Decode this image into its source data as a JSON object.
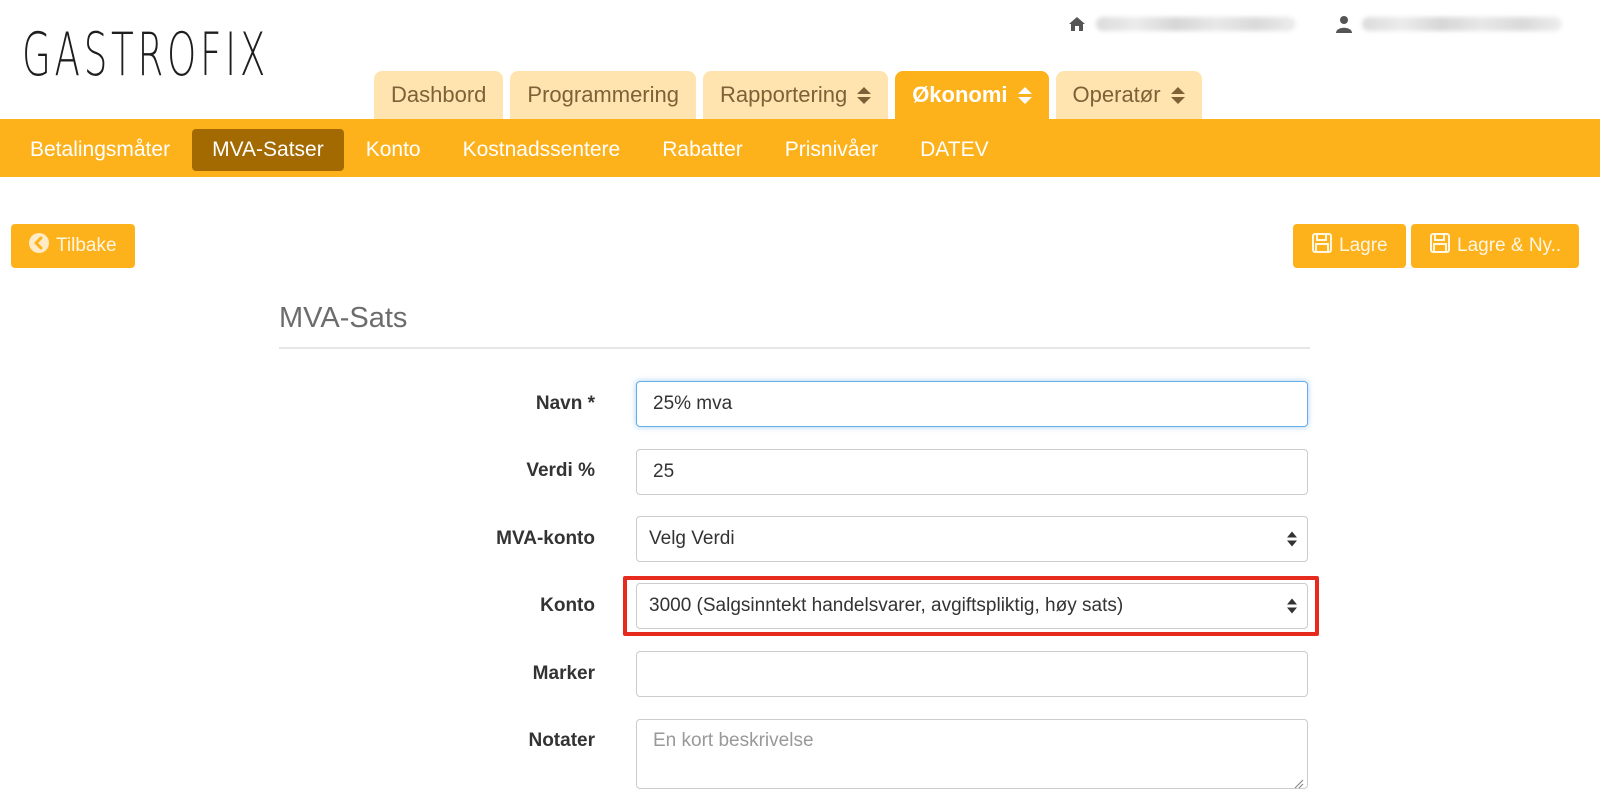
{
  "logo": {
    "text": "GASTROFIX"
  },
  "topbar": {
    "home_icon": "home-icon",
    "user_icon": "user-icon"
  },
  "main_tabs": [
    {
      "label": "Dashbord",
      "has_dropdown": false,
      "active": false
    },
    {
      "label": "Programmering",
      "has_dropdown": false,
      "active": false
    },
    {
      "label": "Rapportering",
      "has_dropdown": true,
      "active": false
    },
    {
      "label": "Økonomi",
      "has_dropdown": true,
      "active": true
    },
    {
      "label": "Operatør",
      "has_dropdown": true,
      "active": false
    }
  ],
  "subnav": [
    {
      "label": "Betalingsmåter",
      "active": false
    },
    {
      "label": "MVA-Satser",
      "active": true
    },
    {
      "label": "Konto",
      "active": false
    },
    {
      "label": "Kostnadssentere",
      "active": false
    },
    {
      "label": "Rabatter",
      "active": false
    },
    {
      "label": "Prisnivåer",
      "active": false
    },
    {
      "label": "DATEV",
      "active": false
    }
  ],
  "actions": {
    "back_label": "Tilbake",
    "save_label": "Lagre",
    "save_new_label": "Lagre & Ny.."
  },
  "form": {
    "title": "MVA-Sats",
    "name": {
      "label": "Navn *",
      "value": "25% mva"
    },
    "value_percent": {
      "label": "Verdi %",
      "value": "25"
    },
    "vat_account": {
      "label": "MVA-konto",
      "value": "Velg Verdi"
    },
    "account": {
      "label": "Konto",
      "value": "3000 (Salgsinntekt handelsvarer, avgiftspliktig, høy sats)"
    },
    "marker": {
      "label": "Marker",
      "value": ""
    },
    "notes": {
      "label": "Notater",
      "placeholder": "En kort beskrivelse"
    }
  },
  "colors": {
    "accent": "#fdb11b",
    "tab_inactive": "#ffe4b0",
    "subnav_active": "#a26a00",
    "highlight": "#e62b1e"
  }
}
